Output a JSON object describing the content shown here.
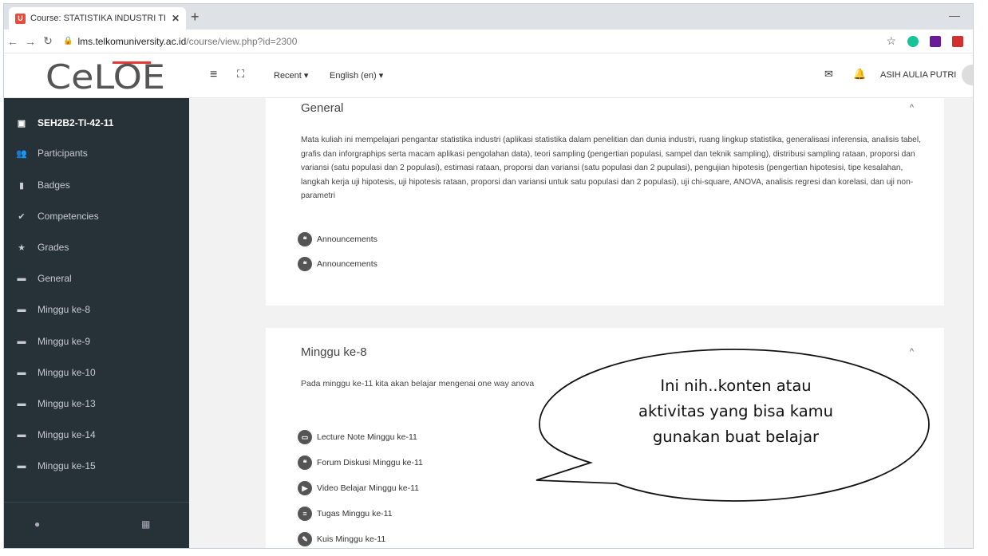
{
  "browser": {
    "tab_title": "Course: STATISTIKA INDUSTRI TI",
    "url_host": "lms.telkomuniversity.ac.id",
    "url_path": "/course/view.php?id=2300"
  },
  "header": {
    "logo_text": "CeLOE",
    "recent_label": "Recent ▾",
    "language_label": "English (en) ▾",
    "username": "ASIH AULIA PUTRI"
  },
  "sidebar": {
    "items": [
      {
        "label": "SEH2B2-TI-42-11",
        "icon": "course-icon"
      },
      {
        "label": "Participants",
        "icon": "users-icon"
      },
      {
        "label": "Badges",
        "icon": "bookmark-icon"
      },
      {
        "label": "Competencies",
        "icon": "check-circle-icon"
      },
      {
        "label": "Grades",
        "icon": "star-icon"
      },
      {
        "label": "General",
        "icon": "folder-icon"
      },
      {
        "label": "Minggu ke-8",
        "icon": "folder-icon"
      },
      {
        "label": "Minggu ke-9",
        "icon": "folder-icon"
      },
      {
        "label": "Minggu ke-10",
        "icon": "folder-icon"
      },
      {
        "label": "Minggu ke-13",
        "icon": "folder-icon"
      },
      {
        "label": "Minggu ke-14",
        "icon": "folder-icon"
      },
      {
        "label": "Minggu ke-15",
        "icon": "folder-icon"
      }
    ]
  },
  "sections": {
    "general": {
      "title": "General",
      "summary": "Mata kuliah ini mempelajari pengantar statistika industri (aplikasi statistika dalam penelitian dan dunia industri, ruang lingkup statistika, generalisasi inferensia, analisis tabel, grafis dan inforgraphips serta macam aplikasi pengolahan data), teori sampling (pengertian populasi, sampel dan teknik sampling), distribusi sampling rataan, proporsi dan variansi (satu populasi dan 2 populasi), estimasi rataan, proporsi dan variansi (satu populasi dan 2 pupulasi), pengujian hipotesis (pengertian hipotesisi, tipe kesalahan, langkah kerja uji hipotesis, uji hipotesis rataan, proporsi dan variansi untuk satu populasi dan 2 populasi), uji chi-square, ANOVA, analisis regresi dan korelasi, dan uji non-parametri",
      "activities": [
        "Announcements",
        "Announcements"
      ]
    },
    "week8": {
      "title": "Minggu ke-8",
      "summary": "Pada minggu ke-11 kita akan belajar mengenai one way anova",
      "activities": [
        "Lecture Note Minggu ke-11",
        "Forum Diskusi Minggu ke-11",
        "Video Belajar Minggu ke-11",
        "Tugas Minggu ke-11",
        "Kuis Minggu ke-11"
      ]
    }
  },
  "callout": {
    "line1": "Ini nih..konten atau",
    "line2": "aktivitas yang bisa kamu",
    "line3": "gunakan buat belajar"
  },
  "colors": {
    "sidebar_bg": "#263238",
    "content_bg": "#f2f2f2",
    "logo_red": "#e53935"
  }
}
